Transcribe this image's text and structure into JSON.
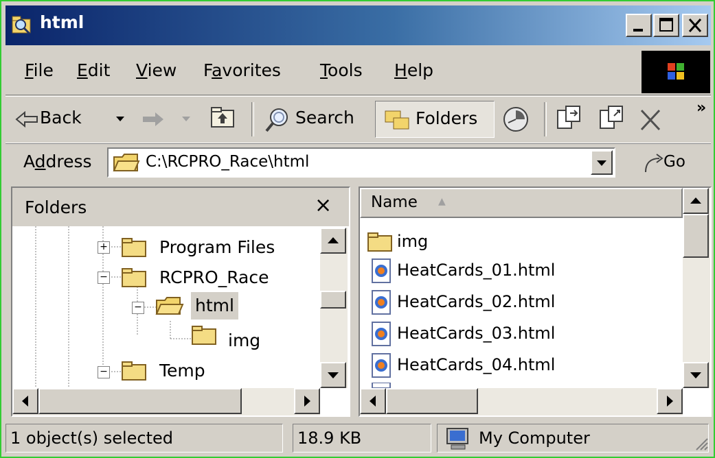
{
  "window": {
    "title": "html",
    "title_icon": "explorer-folder-icon"
  },
  "menu": {
    "items": [
      {
        "label": "File",
        "accel": "F"
      },
      {
        "label": "Edit",
        "accel": "E"
      },
      {
        "label": "View",
        "accel": "V"
      },
      {
        "label": "Favorites",
        "accel": "a"
      },
      {
        "label": "Tools",
        "accel": "T"
      },
      {
        "label": "Help",
        "accel": "H"
      }
    ]
  },
  "toolbar": {
    "back_label": "Back",
    "search_label": "Search",
    "folders_label": "Folders",
    "overflow": "»"
  },
  "address": {
    "label": "Address",
    "path": "C:\\RCPRO_Race\\html",
    "go_label": "Go"
  },
  "folders_pane": {
    "title": "Folders",
    "close": "×",
    "tree": [
      {
        "label": "Program Files",
        "expander": "+"
      },
      {
        "label": "RCPRO_Race",
        "expander": "−"
      },
      {
        "label": "html",
        "expander": "−",
        "selected": true
      },
      {
        "label": "img",
        "expander": ""
      },
      {
        "label": "Temp",
        "expander": "−"
      }
    ]
  },
  "file_list": {
    "column_name": "Name",
    "sort_indicator": "▲",
    "items": [
      {
        "name": "img",
        "icon": "folder-icon"
      },
      {
        "name": "HeatCards_01.html",
        "icon": "html-file-icon"
      },
      {
        "name": "HeatCards_02.html",
        "icon": "html-file-icon"
      },
      {
        "name": "HeatCards_03.html",
        "icon": "html-file-icon"
      },
      {
        "name": "HeatCards_04.html",
        "icon": "html-file-icon"
      }
    ]
  },
  "status": {
    "selection": "1 object(s) selected",
    "size": "18.9 KB",
    "zone": "My Computer"
  },
  "colors": {
    "titlebar_start": "#0a246a",
    "titlebar_end": "#a6caf0",
    "chrome": "#d4d0c8",
    "border": "#33cc33"
  }
}
